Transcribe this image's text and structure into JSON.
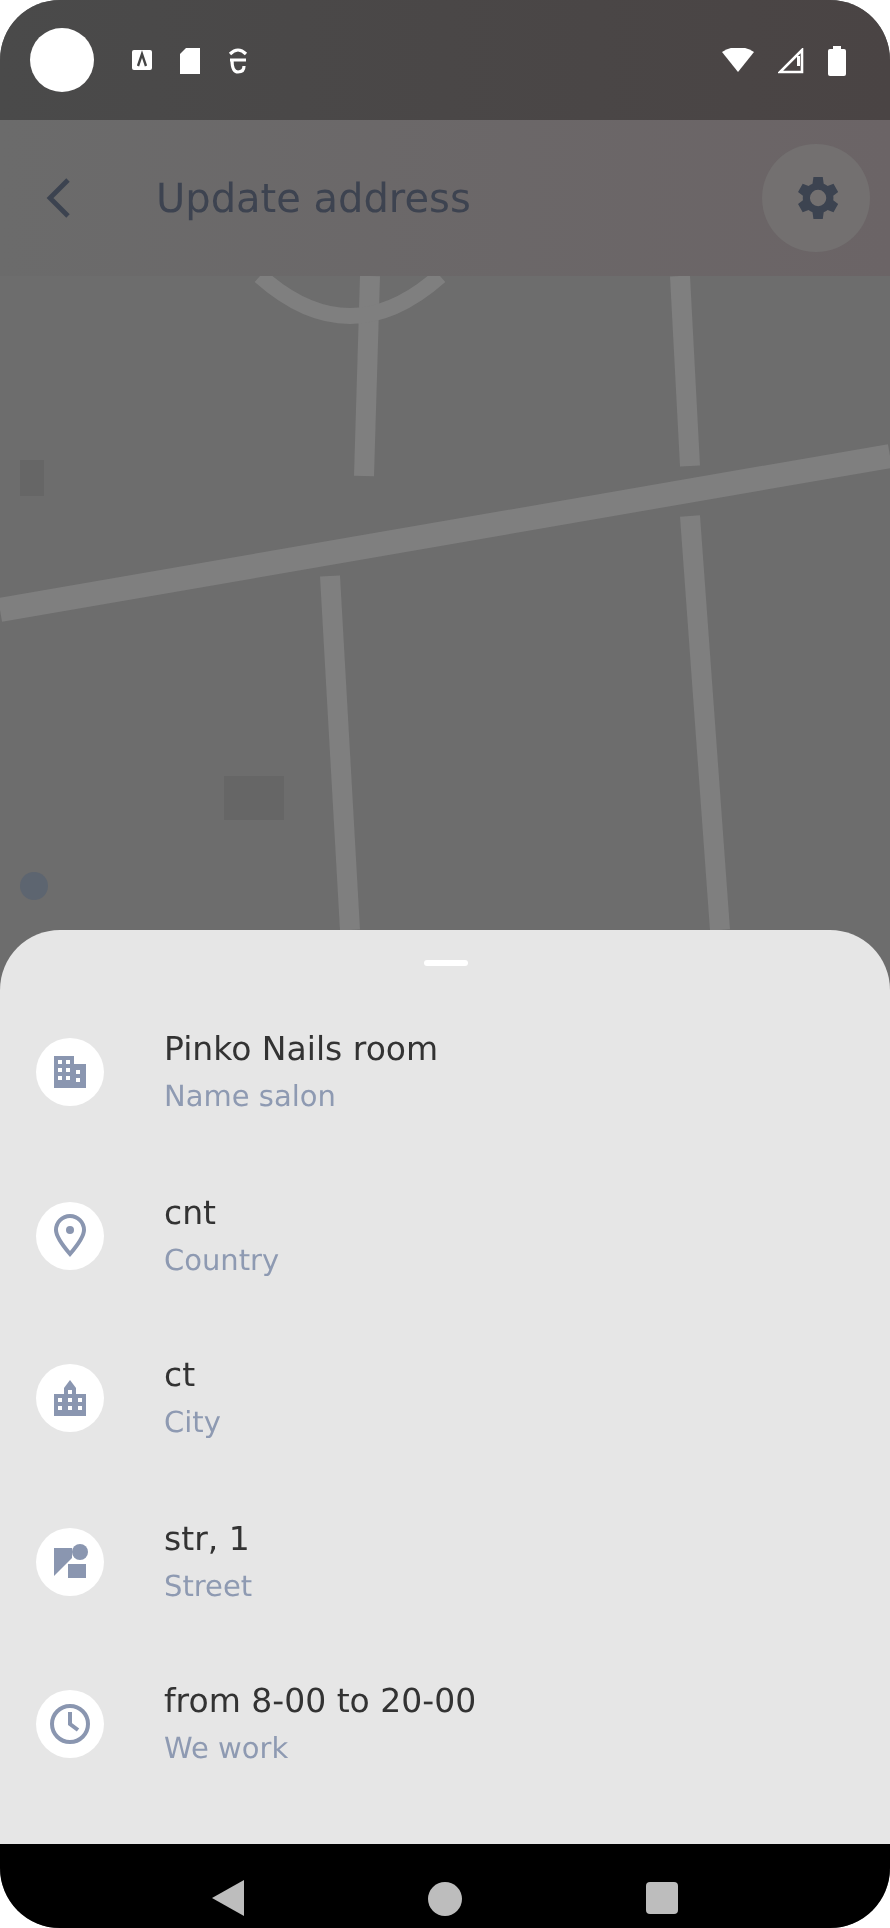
{
  "app_bar": {
    "title": "Update address"
  },
  "sheet": {
    "items": [
      {
        "value": "Pinko Nails room",
        "label": "Name salon"
      },
      {
        "value": "cnt",
        "label": "Country"
      },
      {
        "value": "ct",
        "label": "City"
      },
      {
        "value": "str, 1",
        "label": "Street"
      },
      {
        "value": "from 8-00 to 20-00",
        "label": "We work"
      }
    ]
  }
}
